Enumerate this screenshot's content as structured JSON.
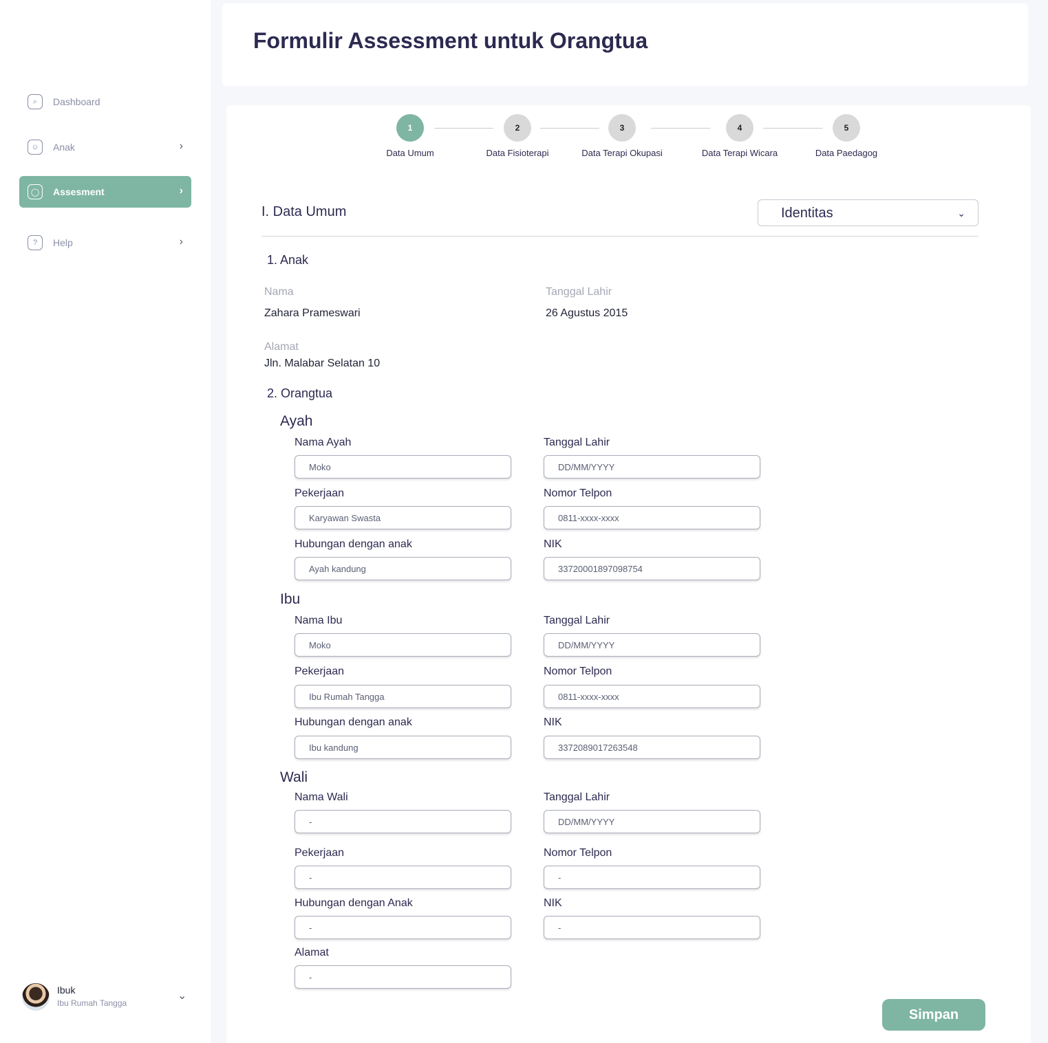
{
  "sidebar": {
    "items": [
      {
        "label": "Dashboard",
        "icon": "dashboard-icon"
      },
      {
        "label": "Anak",
        "icon": "child-icon"
      },
      {
        "label": "Assesment",
        "icon": "user-icon"
      },
      {
        "label": "Help",
        "icon": "help-icon"
      }
    ],
    "active": "Assesment",
    "user": {
      "name": "Ibuk",
      "role": "Ibu Rumah Tangga"
    }
  },
  "header": {
    "title": "Formulir Assessment untuk Orangtua"
  },
  "stepper": {
    "steps": [
      {
        "number": "1",
        "label": "Data Umum"
      },
      {
        "number": "2",
        "label": "Data Fisioterapi"
      },
      {
        "number": "3",
        "label": "Data Terapi Okupasi"
      },
      {
        "number": "4",
        "label": "Data Terapi Wicara"
      },
      {
        "number": "5",
        "label": "Data Paedagog"
      }
    ],
    "current": 1
  },
  "section": {
    "title": "I. Data Umum",
    "dropdown": "Identitas",
    "anak_title": "1. Anak",
    "anak": {
      "nama_label": "Nama",
      "nama": "Zahara Prameswari",
      "tgl_label": "Tanggal Lahir",
      "tgl": "26 Agustus 2015",
      "alamat_label": "Alamat",
      "alamat": "Jln. Malabar Selatan 10"
    },
    "orangtua_title": "2. Orangtua"
  },
  "ayah": {
    "title": "Ayah",
    "nama_label": "Nama Ayah",
    "nama_placeholder": "Moko",
    "tgl_label": "Tanggal Lahir",
    "tgl_placeholder": "DD/MM/YYYY",
    "pekerjaan_label": "Pekerjaan",
    "pekerjaan_placeholder": "Karyawan Swasta",
    "telpon_label": "Nomor Telpon",
    "telpon_placeholder": "0811-xxxx-xxxx",
    "hubungan_label": "Hubungan dengan anak",
    "hubungan_placeholder": "Ayah kandung",
    "nik_label": "NIK",
    "nik_placeholder": "33720001897098754"
  },
  "ibu": {
    "title": "Ibu",
    "nama_label": "Nama Ibu",
    "nama_placeholder": "Moko",
    "tgl_label": "Tanggal Lahir",
    "tgl_placeholder": "DD/MM/YYYY",
    "pekerjaan_label": "Pekerjaan",
    "pekerjaan_placeholder": "Ibu Rumah Tangga",
    "telpon_label": "Nomor Telpon",
    "telpon_placeholder": "0811-xxxx-xxxx",
    "hubungan_label": "Hubungan dengan anak",
    "hubungan_placeholder": "Ibu kandung",
    "nik_label": "NIK",
    "nik_placeholder": "3372089017263548"
  },
  "wali": {
    "title": "Wali",
    "nama_label": "Nama Wali",
    "nama_placeholder": "-",
    "tgl_label": "Tanggal Lahir",
    "tgl_placeholder": "DD/MM/YYYY",
    "pekerjaan_label": "Pekerjaan",
    "pekerjaan_placeholder": "-",
    "telpon_label": "Nomor Telpon",
    "telpon_placeholder": "-",
    "hubungan_label": "Hubungan dengan Anak",
    "hubungan_placeholder": "-",
    "nik_label": "NIK",
    "nik_placeholder": "-",
    "alamat_label": "Alamat",
    "alamat_placeholder": "-"
  },
  "actions": {
    "save_label": "Simpan"
  },
  "colors": {
    "accent": "#7fb5a3",
    "title": "#2c2a50"
  }
}
